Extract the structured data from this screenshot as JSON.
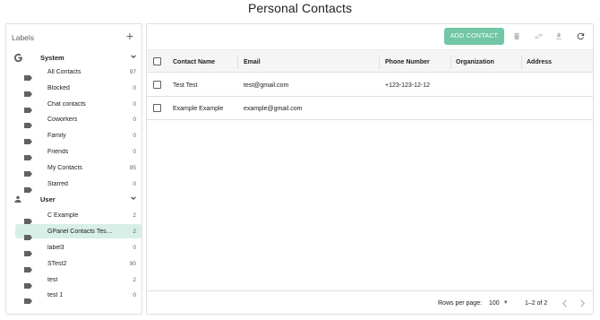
{
  "page": {
    "title": "Personal Contacts"
  },
  "sidebar": {
    "heading": "Labels",
    "add_icon": "plus-icon",
    "groups": [
      {
        "name": "System",
        "icon": "google-icon",
        "items": [
          {
            "label": "All Contacts",
            "count": "97"
          },
          {
            "label": "Blocked",
            "count": "0"
          },
          {
            "label": "Chat contacts",
            "count": "0"
          },
          {
            "label": "Coworkers",
            "count": "0"
          },
          {
            "label": "Family",
            "count": "0"
          },
          {
            "label": "Friends",
            "count": "0"
          },
          {
            "label": "My Contacts",
            "count": "95"
          },
          {
            "label": "Starred",
            "count": "0"
          }
        ]
      },
      {
        "name": "User",
        "icon": "person-icon",
        "items": [
          {
            "label": "C Example",
            "count": "2"
          },
          {
            "label": "GPanel Contacts Tes…",
            "count": "2",
            "active": true
          },
          {
            "label": "label3",
            "count": "0"
          },
          {
            "label": "STest2",
            "count": "90"
          },
          {
            "label": "test",
            "count": "2"
          },
          {
            "label": "test 1",
            "count": "0"
          }
        ]
      }
    ]
  },
  "toolbar": {
    "add_contact_label": "ADD CONTACT",
    "icons": [
      "delete-icon",
      "swap-icon",
      "download-icon",
      "refresh-icon"
    ]
  },
  "table": {
    "columns": [
      "Contact Name",
      "Email",
      "Phone Number",
      "Organization",
      "Address"
    ],
    "rows": [
      {
        "name": "Test Test",
        "email": "test@gmail.com",
        "phone": "+123-123-12-12",
        "organization": "",
        "address": ""
      },
      {
        "name": "Example Example",
        "email": "example@gmail.com",
        "phone": "",
        "organization": "",
        "address": ""
      }
    ]
  },
  "footer": {
    "rows_per_page_label": "Rows per page:",
    "rows_per_page_value": "100",
    "range_text": "1–2 of 2"
  },
  "colors": {
    "accent": "#71c7a6",
    "active_label_bg": "#d7efe6",
    "tag_gray": "#616161"
  }
}
